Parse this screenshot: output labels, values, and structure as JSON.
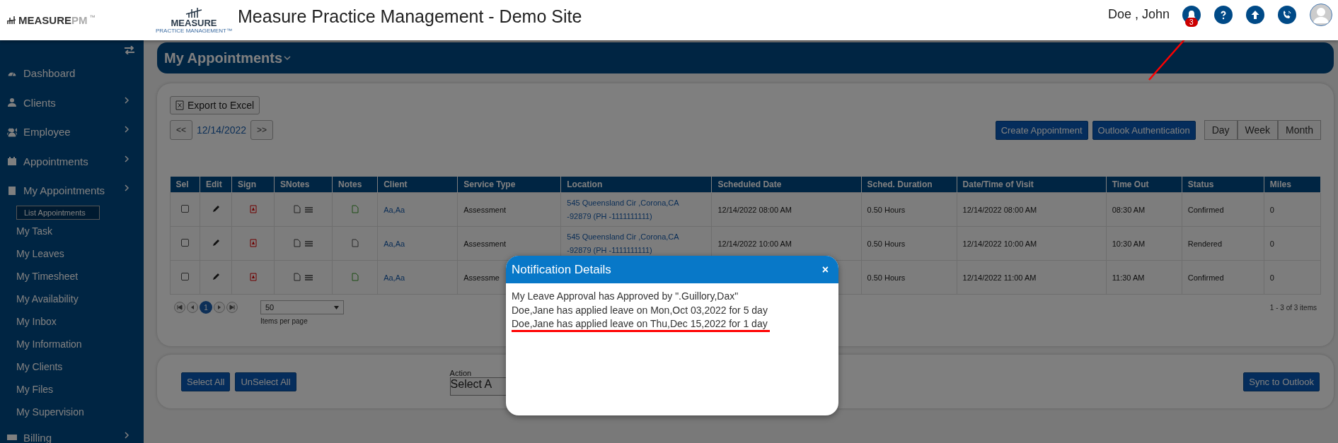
{
  "brand": {
    "logo_text": "MEASURE",
    "logo_suffix": "PM",
    "logo_tm": "™",
    "mark_word": "MEASURE",
    "mark_sub": "PRACTICE MANAGEMENT™"
  },
  "title": "Measure Practice Management - Demo Site",
  "user": {
    "name": "Doe , John",
    "badge": "3"
  },
  "sidebar": {
    "items": [
      {
        "label": "Dashboard",
        "kind": "gauge",
        "has_arrow": false,
        "selected": false
      },
      {
        "label": "Clients",
        "kind": "person",
        "has_arrow": true,
        "selected": false
      },
      {
        "label": "Employee",
        "kind": "people",
        "has_arrow": true,
        "selected": false
      },
      {
        "label": "Appointments",
        "kind": "calendar",
        "has_arrow": true,
        "selected": false
      },
      {
        "label": "My Appointments",
        "kind": "building",
        "has_arrow": true,
        "selected": false,
        "children": [
          {
            "label": "List Appointments",
            "selected": true
          },
          {
            "label": "My Task",
            "selected": false
          },
          {
            "label": "My Leaves",
            "selected": false
          },
          {
            "label": "My Timesheet",
            "selected": false
          },
          {
            "label": "My Availability",
            "selected": false
          },
          {
            "label": "My Inbox",
            "selected": false
          },
          {
            "label": "My Information",
            "selected": false
          },
          {
            "label": "My Clients",
            "selected": false
          },
          {
            "label": "My Files",
            "selected": false
          },
          {
            "label": "My Supervision",
            "selected": false
          }
        ]
      },
      {
        "label": "Billing",
        "kind": "money",
        "has_arrow": true,
        "selected": false
      }
    ]
  },
  "page_header": "My Appointments",
  "toolbar": {
    "export": "Export to Excel",
    "prev": "<<",
    "date": "12/14/2022",
    "next": ">>",
    "create": "Create Appointment",
    "outlook": "Outlook Authentication",
    "views": [
      {
        "label": "Day",
        "selected": false
      },
      {
        "label": "Week",
        "selected": false
      },
      {
        "label": "Month",
        "selected": false
      }
    ]
  },
  "table": {
    "columns": [
      "Sel",
      "Edit",
      "Sign",
      "SNotes",
      "Notes",
      "Client",
      "Service Type",
      "Location",
      "Scheduled Date",
      "Sched. Duration",
      "Date/Time of Visit",
      "Time Out",
      "Status",
      "Miles"
    ],
    "rows": [
      {
        "checked": false,
        "notes_done": true,
        "client": "Aa,Aa",
        "service": "Assessment",
        "location": [
          "545 Queensland Cir ,Corona,CA",
          "-92879 (PH -1111111111)"
        ],
        "scheduled": "12/14/2022 08:00 AM",
        "duration": "0.50 Hours",
        "visit": "12/14/2022 08:00 AM",
        "time_out": "08:30 AM",
        "status": "Confirmed",
        "miles": "0"
      },
      {
        "checked": false,
        "notes_done": false,
        "client": "Aa,Aa",
        "service": "Assessment",
        "location": [
          "545 Queensland Cir ,Corona,CA",
          "-92879 (PH -1111111111)"
        ],
        "scheduled": "12/14/2022 10:00 AM",
        "duration": "0.50 Hours",
        "visit": "12/14/2022 10:00 AM",
        "time_out": "10:30 AM",
        "status": "Rendered",
        "miles": "0"
      },
      {
        "checked": false,
        "notes_done": true,
        "client": "Aa,Aa",
        "service": "Assessme",
        "location": [],
        "scheduled": "",
        "duration": "0.50 Hours",
        "visit": "12/14/2022 11:00 AM",
        "time_out": "11:30 AM",
        "status": "Confirmed",
        "miles": "0"
      }
    ]
  },
  "pager": {
    "page": "1",
    "page_size": "50",
    "page_size_label": "Items per page",
    "summary": "1 - 3 of 3 items"
  },
  "footer": {
    "select_all": "Select All",
    "unselect_all": "UnSelect All",
    "action_label": "Action",
    "action_value": "Select A",
    "sync": "Sync to Outlook"
  },
  "modal": {
    "title": "Notification Details",
    "close": "×",
    "lines": [
      {
        "text": "My Leave Approval has Approved by \".Guillory,Dax\"",
        "underlined": false
      },
      {
        "text": "Doe,Jane has applied leave on Mon,Oct 03,2022 for 5 day",
        "underlined": false
      },
      {
        "text": "Doe,Jane has applied leave on Thu,Dec 15,2022 for 1 day",
        "underlined": true
      }
    ]
  },
  "annotation": {
    "arrow": true
  }
}
